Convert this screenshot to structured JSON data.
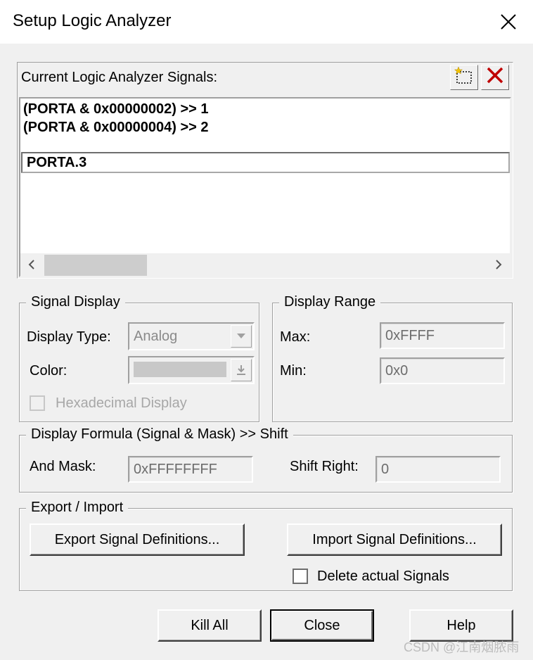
{
  "window": {
    "title": "Setup Logic Analyzer"
  },
  "signals": {
    "header_label": "Current Logic Analyzer Signals:",
    "items": [
      "(PORTA & 0x00000002) >> 1",
      "(PORTA & 0x00000004) >> 2"
    ],
    "editing_value": "PORTA.3"
  },
  "signal_display": {
    "title": "Signal Display",
    "display_type_label": "Display Type:",
    "display_type_value": "Analog",
    "color_label": "Color:",
    "hex_label": "Hexadecimal Display"
  },
  "display_range": {
    "title": "Display Range",
    "max_label": "Max:",
    "max_value": "0xFFFF",
    "min_label": "Min:",
    "min_value": "0x0"
  },
  "formula": {
    "title": "Display Formula (Signal & Mask) >> Shift",
    "and_mask_label": "And Mask:",
    "and_mask_value": "0xFFFFFFFF",
    "shift_label": "Shift Right:",
    "shift_value": "0"
  },
  "export_import": {
    "title": "Export / Import",
    "export_button": "Export Signal Definitions...",
    "import_button": "Import Signal Definitions...",
    "delete_label": "Delete actual Signals"
  },
  "buttons": {
    "kill_all": "Kill All",
    "close": "Close",
    "help": "Help"
  },
  "watermark": "CSDN @江南烟脓雨",
  "colors": {
    "delete_icon": "#c00000",
    "new_icon_star": "#f2c200"
  }
}
